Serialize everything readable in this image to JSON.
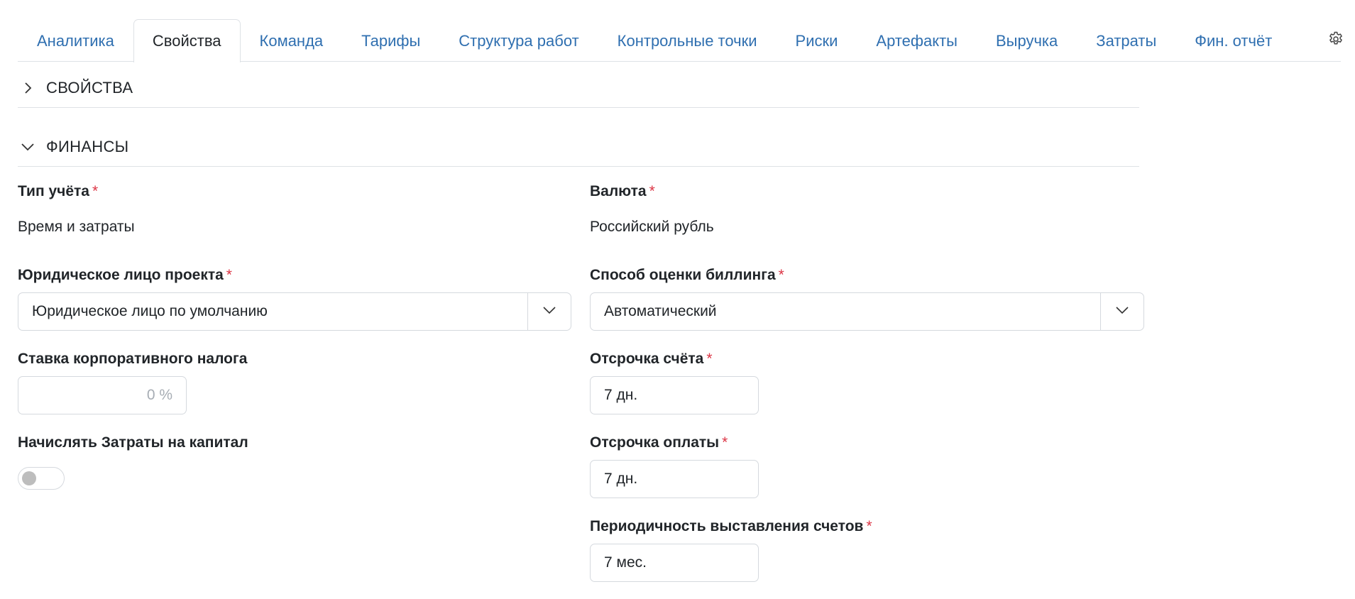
{
  "tabs": [
    {
      "label": "Аналитика"
    },
    {
      "label": "Свойства"
    },
    {
      "label": "Команда"
    },
    {
      "label": "Тарифы"
    },
    {
      "label": "Структура работ"
    },
    {
      "label": "Контрольные точки"
    },
    {
      "label": "Риски"
    },
    {
      "label": "Артефакты"
    },
    {
      "label": "Выручка"
    },
    {
      "label": "Затраты"
    },
    {
      "label": "Фин. отчёт"
    }
  ],
  "active_tab": "Свойства",
  "settings_icon": "gear-icon",
  "sections": {
    "properties": {
      "title": "СВОЙСТВА",
      "expanded": false
    },
    "finance": {
      "title": "ФИНАНСЫ",
      "expanded": true
    }
  },
  "required_mark": "*",
  "fields": {
    "accounting_type": {
      "label": "Тип учёта",
      "value": "Время и затраты"
    },
    "currency": {
      "label": "Валюта",
      "value": "Российский рубль"
    },
    "legal_entity": {
      "label": "Юридическое лицо проекта",
      "value": "Юридическое лицо по умолчанию"
    },
    "billing_method": {
      "label": "Способ оценки биллинга",
      "value": "Автоматический"
    },
    "corporate_tax": {
      "label": "Ставка корпоративного налога",
      "placeholder": "0 %"
    },
    "invoice_delay": {
      "label": "Отсрочка счёта",
      "value": "7 дн."
    },
    "capital_costs": {
      "label": "Начислять Затраты на капитал",
      "enabled": false
    },
    "payment_delay": {
      "label": "Отсрочка оплаты",
      "value": "7 дн."
    },
    "billing_period": {
      "label": "Периодичность выставления счетов",
      "value": "7 мес."
    }
  },
  "colors": {
    "link": "#2f6fb0",
    "required": "#dc3545",
    "border": "#d5d9de"
  }
}
